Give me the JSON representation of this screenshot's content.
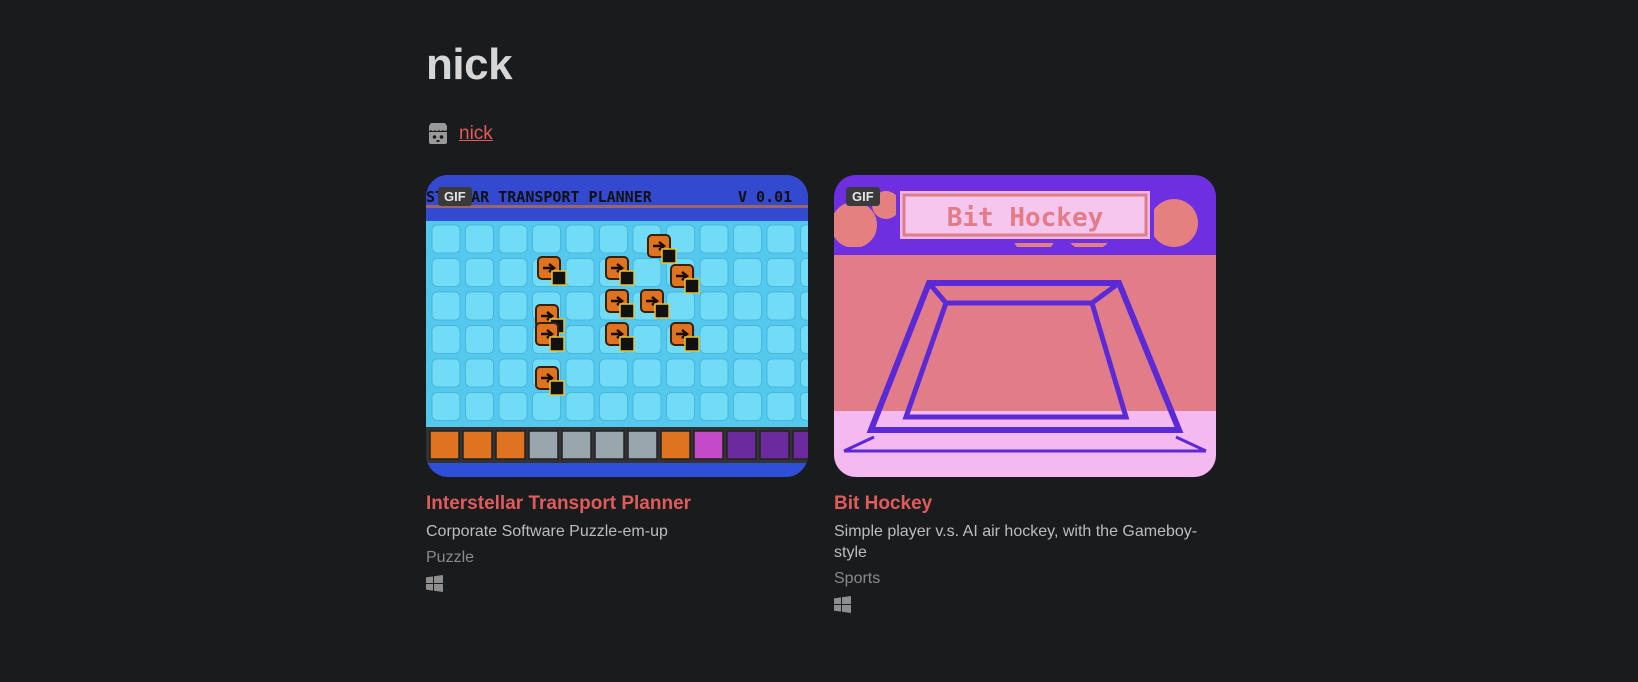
{
  "profile": {
    "title": "nick",
    "link_label": "nick"
  },
  "games": [
    {
      "title": "Interstellar Transport Planner",
      "description": "Corporate Software Puzzle-em-up",
      "genre": "Puzzle",
      "badge": "GIF",
      "platform_icon": "windows-icon",
      "banner_text": "STELLAR TRANSPORT PLANNER",
      "version_text": "V 0.01"
    },
    {
      "title": "Bit Hockey",
      "description": "Simple player v.s. AI air hockey, with the Gameboy-style",
      "genre": "Sports",
      "badge": "GIF",
      "platform_icon": "windows-icon",
      "banner_text": "Bit Hockey"
    }
  ],
  "colors": {
    "background": "#1a1b1c",
    "accent": "#e05b5b",
    "title": "#d6d6d6",
    "muted": "#8a8a8a"
  }
}
